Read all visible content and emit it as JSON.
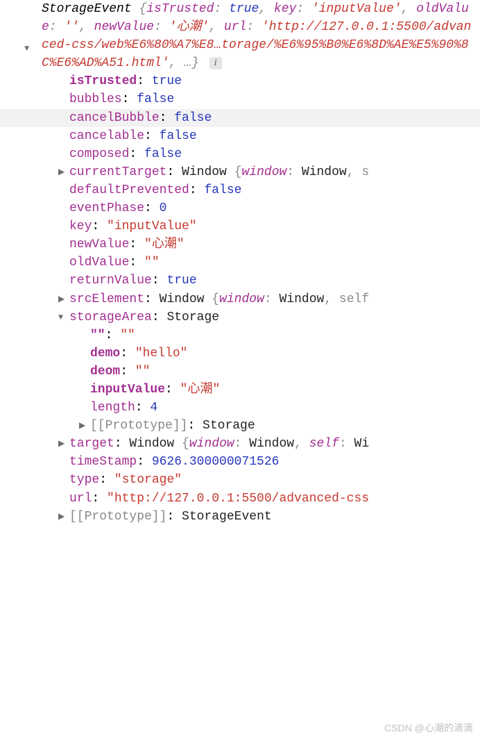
{
  "summary": {
    "class": "StorageEvent",
    "isTrusted_key": "isTrusted",
    "isTrusted_val": "true",
    "key_key": "key",
    "key_val": "'inputValue'",
    "oldValue_key": "oldValue",
    "oldValue_val": "''",
    "newValue_key": "newValue",
    "newValue_val": "'心潮'",
    "url_key": "url",
    "url_val": "'http://127.0.0.1:5500/advanced-css/web%E6%80%A7%E8…torage/%E6%95%B0%E6%8D%AE%E5%90%8C%E6%AD%A51.html'",
    "ellipsis": "…"
  },
  "props": {
    "isTrusted": {
      "k": "isTrusted",
      "v": "true"
    },
    "bubbles": {
      "k": "bubbles",
      "v": "false"
    },
    "cancelBubble": {
      "k": "cancelBubble",
      "v": "false"
    },
    "cancelable": {
      "k": "cancelable",
      "v": "false"
    },
    "composed": {
      "k": "composed",
      "v": "false"
    },
    "currentTarget": {
      "k": "currentTarget",
      "type": "Window",
      "preview": "{window: Window, s"
    },
    "defaultPrevented": {
      "k": "defaultPrevented",
      "v": "false"
    },
    "eventPhase": {
      "k": "eventPhase",
      "v": "0"
    },
    "key": {
      "k": "key",
      "v": "\"inputValue\""
    },
    "newValue": {
      "k": "newValue",
      "v": "\"心潮\""
    },
    "oldValue": {
      "k": "oldValue",
      "v": "\"\""
    },
    "returnValue": {
      "k": "returnValue",
      "v": "true"
    },
    "srcElement": {
      "k": "srcElement",
      "type": "Window",
      "preview": "{window: Window, self"
    },
    "storageArea": {
      "k": "storageArea",
      "type": "Storage"
    },
    "target": {
      "k": "target",
      "type": "Window",
      "preview": "{window: Window, self: Wi"
    },
    "timeStamp": {
      "k": "timeStamp",
      "v": "9626.300000071526"
    },
    "type": {
      "k": "type",
      "v": "\"storage\""
    },
    "url": {
      "k": "url",
      "v": "\"http://127.0.0.1:5500/advanced-css"
    },
    "proto": {
      "k": "[[Prototype]]",
      "v": "StorageEvent"
    }
  },
  "storage": {
    "empty": {
      "k": "\"\"",
      "v": "\"\""
    },
    "demo": {
      "k": "demo",
      "v": "\"hello\""
    },
    "deom": {
      "k": "deom",
      "v": "\"\""
    },
    "inputValue": {
      "k": "inputValue",
      "v": "\"心潮\""
    },
    "length": {
      "k": "length",
      "v": "4"
    },
    "proto": {
      "k": "[[Prototype]]",
      "v": "Storage"
    }
  },
  "watermark": "CSDN @心潮的滴滴"
}
